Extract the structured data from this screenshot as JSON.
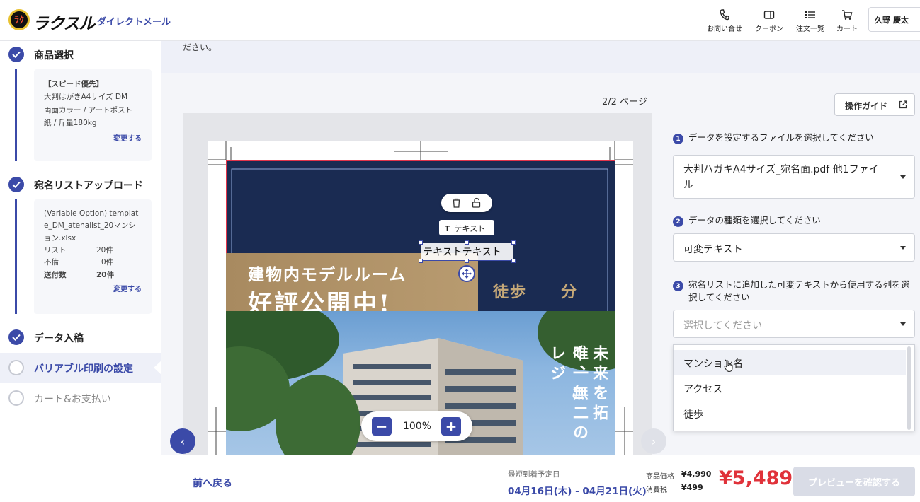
{
  "header": {
    "logo_mark": "ﾗｸ",
    "logo": "ラクスル",
    "subtitle": "ダイレクトメール",
    "nav": {
      "contact": "お問い合せ",
      "coupon": "クーポン",
      "orders": "注文一覧",
      "cart": "カート"
    },
    "user": "久野 慶太"
  },
  "sidebar": {
    "steps": {
      "product": "商品選択",
      "upload": "宛名リストアップロード",
      "data": "データ入稿",
      "variable": "バリアブル印刷の設定",
      "cart": "カート&お支払い"
    },
    "product_card": {
      "line1": "【スピード優先】",
      "line2": "大判はがきA4サイズ DM",
      "line3": "両面カラー / アートポスト",
      "line4": "紙 / 斤量180kg",
      "link": "変更する"
    },
    "list_card": {
      "filename1": "(Variable Option) templat",
      "filename2": "e_DM_atenalist_20マンシ",
      "filename3": "ョン.xlsx",
      "list_label": "リスト",
      "list_value": "20件",
      "invalid_label": "不備",
      "invalid_value": "0件",
      "send_label": "送付数",
      "send_value": "20件",
      "link": "変更する"
    }
  },
  "banner": {
    "text": "ださい。"
  },
  "preview": {
    "page_count": "2/2 ページ",
    "tag_label": "テキスト",
    "text_box": "テキストテキスト",
    "headline1": "建物内モデルルーム",
    "headline2": "好評公開中!",
    "walk_text": "徒歩　　分",
    "vert_col1": "未来を拓く、こ",
    "vert_col2": "唯一無二のレジ",
    "zoom": "100%",
    "zoom_minus": "−",
    "zoom_plus": "+",
    "prev": "‹",
    "next": "›"
  },
  "panel": {
    "guide_button": "操作ガイド",
    "q1": {
      "num": "1",
      "label": "データを設定するファイルを選択してください",
      "value1": "大判ハガキA4サイズ_宛名面.pdf 他1ファイ",
      "value2": "ル"
    },
    "q2": {
      "num": "2",
      "label": "データの種類を選択してください",
      "value": "可変テキスト"
    },
    "q3": {
      "num": "3",
      "label1": "宛名リストに追加した可変テキストから使用する列を選",
      "label2": "択してください",
      "placeholder": "選択してください"
    },
    "options": [
      "マンション名",
      "アクセス",
      "徒歩"
    ]
  },
  "footer": {
    "back": "前へ戻る",
    "delivery_label": "最短到着予定日",
    "delivery_value": "04月16日(木) - 04月21日(火)",
    "price_label": "商品価格",
    "price_value": "¥4,990",
    "tax_label": "消費税",
    "tax_value": "¥499",
    "total": "¥5,489",
    "confirm": "プレビューを確認する"
  },
  "colors": {
    "brand": "#3b4aa8",
    "total": "#e0323a",
    "navy": "#1a2b52",
    "gold": "#b09468"
  }
}
